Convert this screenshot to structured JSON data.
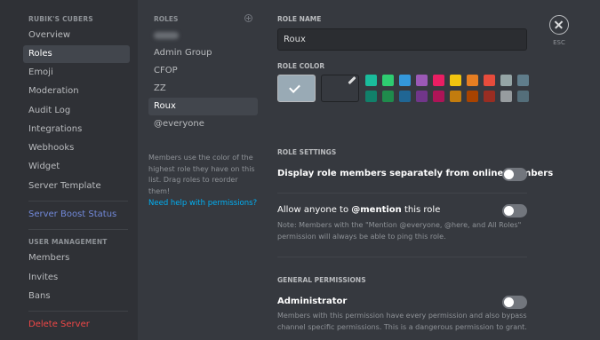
{
  "sidebar": {
    "server_header": "RUBIK'S CUBERS",
    "items": [
      {
        "label": "Overview"
      },
      {
        "label": "Roles"
      },
      {
        "label": "Emoji"
      },
      {
        "label": "Moderation"
      },
      {
        "label": "Audit Log"
      },
      {
        "label": "Integrations"
      },
      {
        "label": "Webhooks"
      },
      {
        "label": "Widget"
      },
      {
        "label": "Server Template"
      }
    ],
    "boost_label": "Server Boost Status",
    "user_mgmt_header": "USER MANAGEMENT",
    "user_items": [
      {
        "label": "Members"
      },
      {
        "label": "Invites"
      },
      {
        "label": "Bans"
      }
    ],
    "delete_label": "Delete Server"
  },
  "roles_panel": {
    "header": "ROLES",
    "roles": [
      {
        "label": "Admin Group"
      },
      {
        "label": "CFOP"
      },
      {
        "label": "ZZ"
      },
      {
        "label": "Roux"
      },
      {
        "label": "@everyone"
      }
    ],
    "note": "Members use the color of the highest role they have on this list. Drag roles to reorder them!",
    "help_link": "Need help with permissions?"
  },
  "editor": {
    "role_name_label": "ROLE NAME",
    "role_name_value": "Roux",
    "role_color_label": "ROLE COLOR",
    "selected_color": "#99aab5",
    "swatches_row1": [
      "#1abc9c",
      "#2ecc71",
      "#3498db",
      "#9b59b6",
      "#e91e63",
      "#f1c40f",
      "#e67e22",
      "#e74c3c",
      "#95a5a6",
      "#607d8b"
    ],
    "swatches_row2": [
      "#11806a",
      "#1f8b4c",
      "#206694",
      "#71368a",
      "#ad1457",
      "#c27c0e",
      "#a84300",
      "#992d22",
      "#979c9f",
      "#546e7a"
    ],
    "role_settings_label": "ROLE SETTINGS",
    "display_separately": "Display role members separately from online members",
    "allow_mention_prefix": "Allow anyone to ",
    "allow_mention_bold": "@mention",
    "allow_mention_suffix": " this role",
    "mention_note": "Note: Members with the \"Mention @everyone, @here, and All Roles\" permission will always be able to ping this role.",
    "general_permissions_label": "GENERAL PERMISSIONS",
    "administrator": "Administrator",
    "administrator_note": "Members with this permission have every permission and also bypass channel specific permissions. This is a dangerous permission to grant.",
    "esc_label": "ESC"
  }
}
